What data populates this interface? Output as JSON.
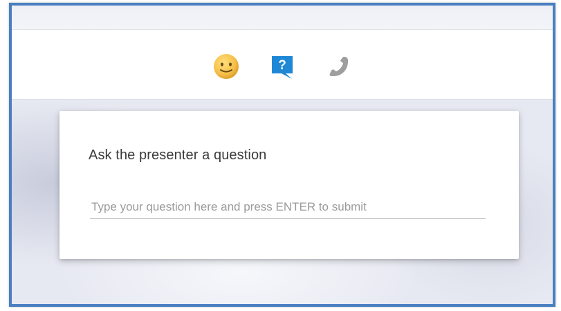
{
  "toolbar": {
    "icons": [
      {
        "name": "smiley-emoji-icon"
      },
      {
        "name": "question-chat-icon",
        "glyph": "?"
      },
      {
        "name": "phone-icon"
      }
    ],
    "colors": {
      "emoji": "#f5c04a",
      "question_bubble": "#1e88d6",
      "phone": "#9e9e9e",
      "frame_border": "#4a7fc1"
    }
  },
  "question_panel": {
    "title": "Ask the presenter a question",
    "input_value": "",
    "input_placeholder": "Type your question here and press ENTER to submit"
  }
}
